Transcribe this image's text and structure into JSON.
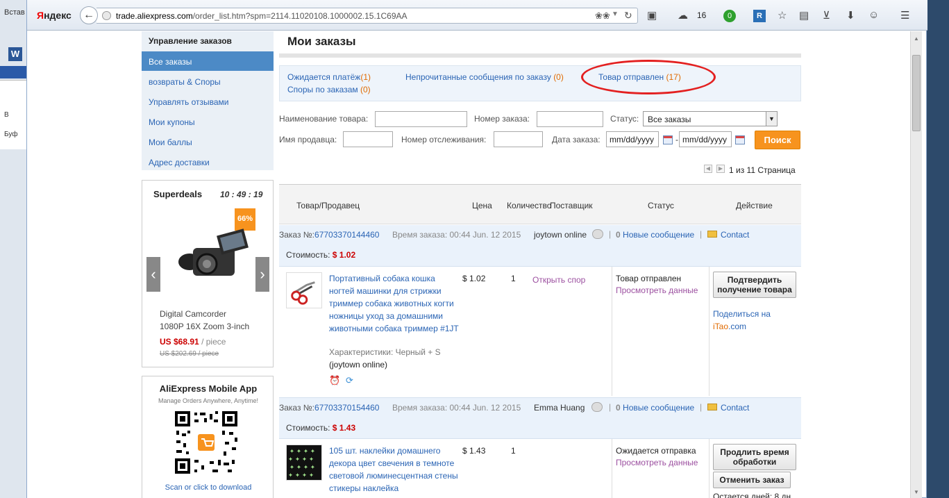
{
  "background_app": {
    "tab_label": "Встав",
    "word_icon": "W",
    "side_label_1": "В",
    "side_label_2": "Буф"
  },
  "browser": {
    "brand": "Яндекс",
    "url": "trade.aliexpress.com/order_list.htm?spm=2114.11020108.1000002.15.1C69AA",
    "url_domain": "trade.aliexpress.com",
    "url_path": "/order_list.htm?spm=2114.11020108.1000002.15.1C69AA",
    "weather_temp": "16",
    "mail_badge": "0",
    "ext_badge": "R"
  },
  "sidebar": {
    "header": "Управление заказов",
    "items": [
      {
        "label": "Все заказы",
        "active": true
      },
      {
        "label": "возвраты & Споры"
      },
      {
        "label": "Управлять отзывами"
      },
      {
        "label": "Мои купоны"
      },
      {
        "label": "Мои баллы"
      },
      {
        "label": "Адрес доставки"
      }
    ]
  },
  "superdeals": {
    "title": "Superdeals",
    "timer": "10 : 49 : 19",
    "discount": "66%",
    "product_line1": "Digital Camcorder",
    "product_line2": "1080P 16X Zoom 3-inch",
    "price": "US $68.91",
    "price_unit": "/ piece",
    "old_price": "US $202.69",
    "old_unit": "/ piece"
  },
  "mobile_app": {
    "title": "AliExpress Mobile App",
    "subtitle": "Manage Orders Anywhere, Anytime!",
    "link": "Scan or click to download"
  },
  "page": {
    "title": "Мои заказы",
    "filters": {
      "awaiting_payment": "Ожидается платёж",
      "awaiting_payment_count": "(1)",
      "unread_messages": "Непрочитанные сообщения по заказу",
      "unread_messages_count": "(0)",
      "shipped": "Товар отправлен",
      "shipped_count": "(17)",
      "disputes": "Споры по заказам",
      "disputes_count": "(0)"
    },
    "search": {
      "product_name_label": "Наименование товара:",
      "order_number_label": "Номер заказа:",
      "status_label": "Статус:",
      "status_value": "Все заказы",
      "seller_name_label": "Имя продавца:",
      "tracking_label": "Номер отслеживания:",
      "order_date_label": "Дата заказа:",
      "date_from": "mm/dd/yyyy",
      "date_sep": "-",
      "date_to": "mm/dd/yyyy",
      "search_button": "Поиск"
    },
    "pagination": "1 из 11 Страница",
    "table_headers": {
      "product": "Товар/Продавец",
      "price": "Цена",
      "qty": "Количество",
      "supplier": "Поставщик",
      "status": "Статус",
      "action": "Действие"
    },
    "orders": [
      {
        "order_label": "Заказ №:",
        "order_number": "67703370144460",
        "order_time": "Время заказа: 00:44 Jun. 12 2015",
        "seller": "joytown online",
        "new_msg_count": "0",
        "new_msg_label": "Новые сообщение",
        "contact": "Contact",
        "cost_label": "Стоимость:",
        "cost": "$ 1.02",
        "product_name": "Портативный собака кошка ногтей машинки для стрижки триммер собака животных когти ножницы уход за домашними животными собака триммер #1JT",
        "characteristics": "Характеристики: Черный   + S",
        "product_seller": "(joytown online)",
        "price": "$ 1.02",
        "qty": "1",
        "dispute": "Открыть спор",
        "status": "Товар отправлен",
        "view": "Просмотреть данные",
        "action_button": "Подтвердить получение товара",
        "share_text": "Поделиться на",
        "share_site_i": "iTao",
        "share_site_rest": ".com"
      },
      {
        "order_label": "Заказ №:",
        "order_number": "67703370154460",
        "order_time": "Время заказа: 00:44 Jun. 12 2015",
        "seller": "Emma Huang",
        "new_msg_count": "0",
        "new_msg_label": "Новые сообщение",
        "contact": "Contact",
        "cost_label": "Стоимость:",
        "cost": "$ 1.43",
        "product_name": "105 шт. наклейки домашнего декора цвет свечения в темноте световой люминесцентная стены стикеры наклейка",
        "price": "$ 1.43",
        "qty": "1",
        "status": "Ожидается отправка",
        "view": "Просмотреть данные",
        "action_button": "Продлить время обработки",
        "cancel_button": "Отменить заказ",
        "remaining": "Остается дней: 8 дн"
      }
    ]
  },
  "colors": {
    "accent_orange": "#f7931e",
    "link_blue": "#2a64b4",
    "price_red": "#cc0000",
    "highlight_circle": "#e32020"
  }
}
